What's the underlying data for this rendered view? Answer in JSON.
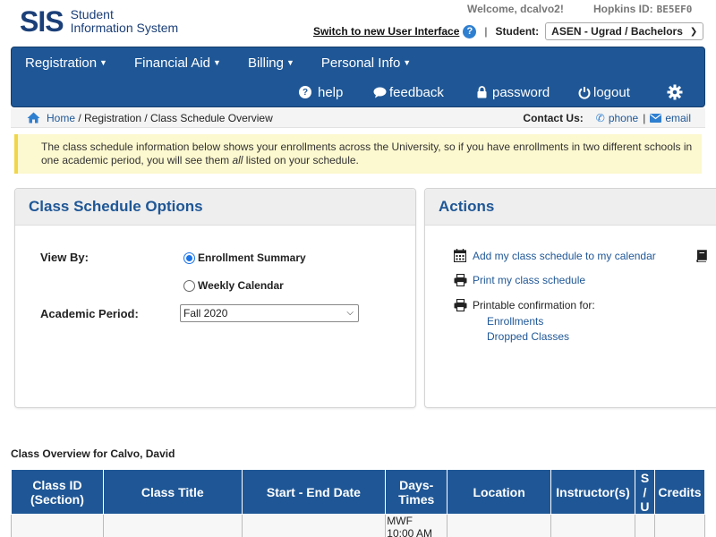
{
  "header": {
    "logo_main": "SIS",
    "logo_line1": "Student",
    "logo_line2": "Information System",
    "welcome": "Welcome, dcalvo2!",
    "hopkins_label": "Hopkins ID:",
    "hopkins_id": "BE5EF0",
    "switch_link": "Switch to new User Interface",
    "student_label": "Student:",
    "student_value": "ASEN - Ugrad / Bachelors"
  },
  "nav": {
    "menus": [
      "Registration",
      "Financial Aid",
      "Billing",
      "Personal Info"
    ],
    "help": "help",
    "feedback": "feedback",
    "password": "password",
    "logout": "logout"
  },
  "breadcrumb": {
    "home": "Home",
    "sep1": " / Registration / Class Schedule Overview",
    "contact_label": "Contact Us:",
    "phone": "phone",
    "email": "email"
  },
  "notice": {
    "text_a": "The class schedule information below shows your enrollments across the University, so if you have enrollments in two different schools in one academic period, you will see them ",
    "text_em": "all",
    "text_b": " listed on your schedule."
  },
  "options": {
    "title": "Class Schedule Options",
    "view_by_label": "View By:",
    "radio_summary": "Enrollment Summary",
    "radio_weekly": "Weekly Calendar",
    "period_label": "Academic Period:",
    "period_value": "Fall 2020"
  },
  "actions": {
    "title": "Actions",
    "add_calendar": "Add my class schedule to my calendar",
    "print_schedule": "Print my class schedule",
    "printable_label": "Printable confirmation for:",
    "enrollments": "Enrollments",
    "dropped": "Dropped Classes"
  },
  "overview": {
    "title": "Class Overview for Calvo, David",
    "columns": {
      "class_id_1": "Class ID",
      "class_id_2": "(Section)",
      "class_title": "Class Title",
      "dates": "Start - End Date",
      "days_1": "Days-",
      "days_2": "Times",
      "location": "Location",
      "instructor": "Instructor(s)",
      "su_1": "S",
      "su_2": "/",
      "su_3": "U",
      "credits": "Credits"
    },
    "row1_days": "MWF",
    "row1_time": "10:00 AM"
  }
}
